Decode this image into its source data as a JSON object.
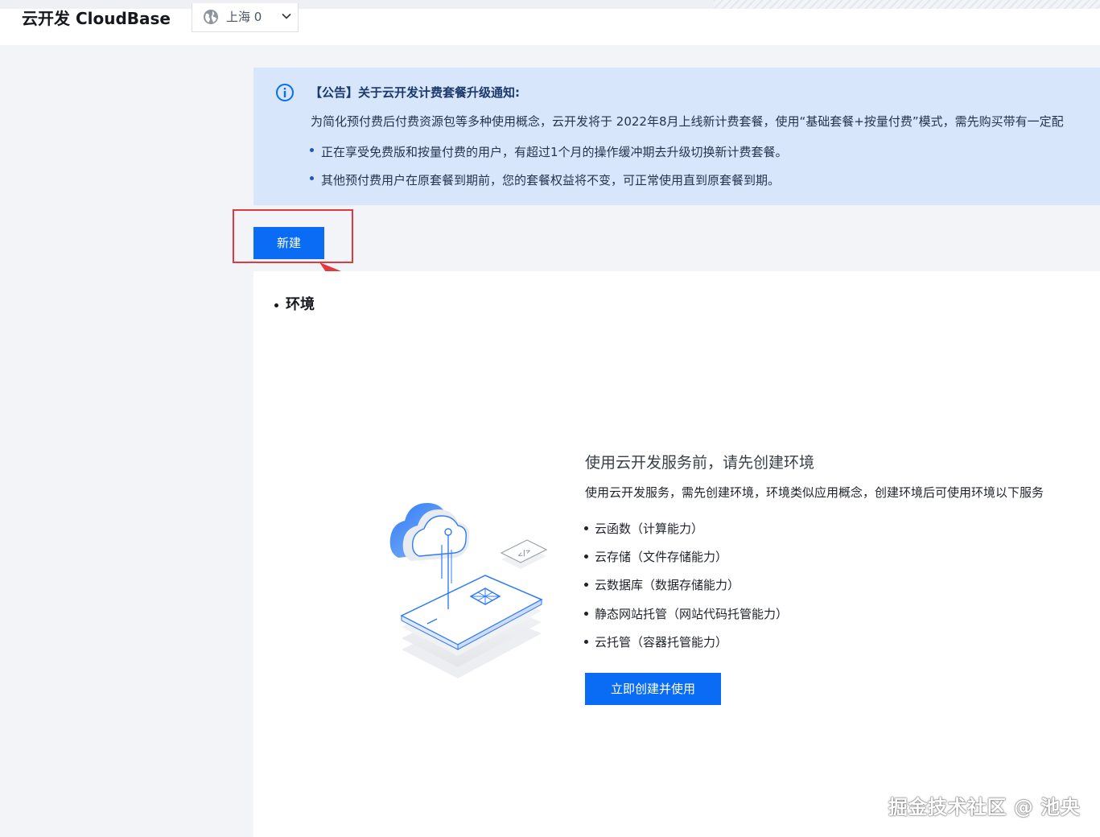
{
  "header": {
    "app_title": "云开发 CloudBase",
    "region": {
      "label": "上海 0",
      "icon": "globe-icon"
    }
  },
  "notice": {
    "icon": "info-icon",
    "title": "【公告】关于云开发计费套餐升级通知:",
    "description": "为简化预付费后付费资源包等多种使用概念，云开发将于 2022年8月上线新计费套餐，使用“基础套餐+按量付费”模式，需先购买带有一定配",
    "bullets": [
      "正在享受免费版和按量付费的用户，有超过1个月的操作缓冲期去升级切换新计费套餐。",
      "其他预付费用户在原套餐到期前，您的套餐权益将不变，可正常使用直到原套餐到期。"
    ]
  },
  "toolbar": {
    "new_label": "新建"
  },
  "environment": {
    "section_title": "环境",
    "empty_state": {
      "title": "使用云开发服务前，请先创建环境",
      "description": "使用云开发服务，需先创建环境，环境类似应用概念，创建环境后可使用环境以下服务",
      "services": [
        "云函数（计算能力）",
        "云存储（文件存储能力）",
        "云数据库（数据存储能力）",
        "静态网站托管（网站代码托管能力）",
        "云托管（容器托管能力）"
      ],
      "create_label": "立即创建并使用"
    }
  },
  "watermark": "掘金技术社区 @ 池央",
  "colors": {
    "primary": "#0a6cf5",
    "notice_bg": "#d8e6fc",
    "highlight": "#e0393e"
  }
}
